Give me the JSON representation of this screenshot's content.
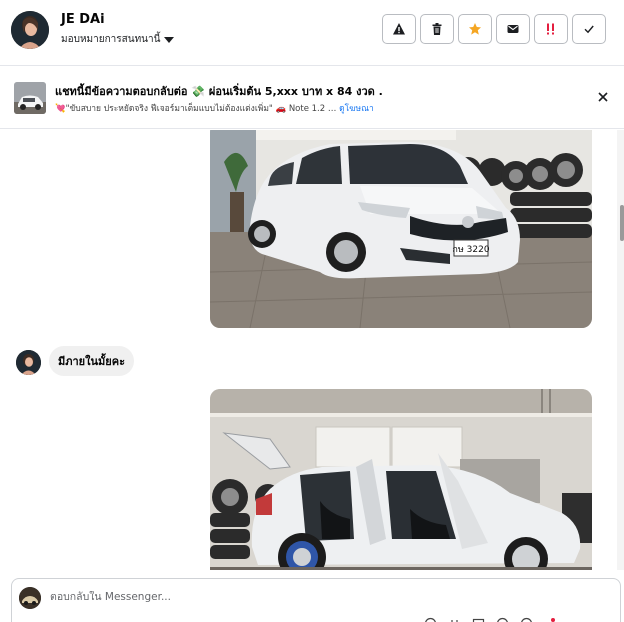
{
  "header": {
    "contact_name": "JE DAi",
    "assign_label": "มอบหมายการสนทนานี้",
    "actions": [
      {
        "name": "report-spam-icon",
        "symbol": "warning"
      },
      {
        "name": "trash-icon",
        "symbol": "delete"
      },
      {
        "name": "star-icon",
        "symbol": "star"
      },
      {
        "name": "mail-icon",
        "symbol": "mark-unread"
      },
      {
        "name": "follow-up-icon",
        "symbol": "priority"
      },
      {
        "name": "checkmark-icon",
        "symbol": "done"
      }
    ]
  },
  "ad_banner": {
    "title": "แชทนี้มีข้อความตอบกลับต่อ 💸 ผ่อนเริ่มต้น 5,xxx บาท x 84 งวด .",
    "subtitle": "💘\"ขับสบาย ประหยัดจริง ฟีเจอร์มาเต็มแบบไม่ต้องแต่งเพิ่ม\" 🚗 Note 1.2 …",
    "link": "ดูโฆษณา"
  },
  "messages": {
    "incoming_text": "มีภายในมั้ยคะ"
  },
  "car_photo": {
    "plate": "กษ 3220"
  },
  "composer": {
    "placeholder": "ตอบกลับใน Messenger..."
  },
  "colors": {
    "accent": "#1877f2",
    "star": "#f5a623",
    "follow_up": "#e41e3f",
    "bubble": "#f0f0f0"
  }
}
